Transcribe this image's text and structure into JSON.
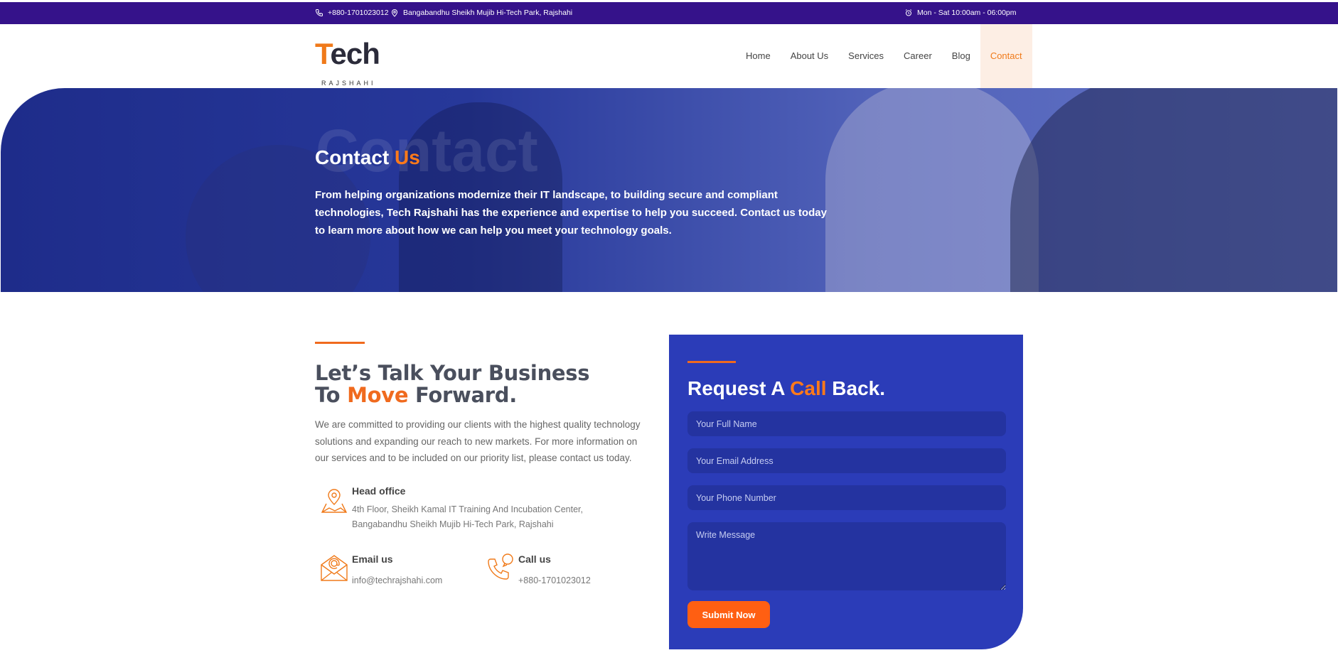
{
  "topbar": {
    "phone": "+880-1701023012",
    "address": "Bangabandhu Sheikh Mujib Hi-Tech Park, Rajshahi",
    "hours": "Mon - Sat 10:00am - 06:00pm"
  },
  "header": {
    "logo_text_first": "T",
    "logo_text_rest": "ech",
    "logo_sub": "RAJSHAHI",
    "nav": [
      {
        "label": "Home",
        "active": false
      },
      {
        "label": "About Us",
        "active": false
      },
      {
        "label": "Services",
        "active": false
      },
      {
        "label": "Career",
        "active": false
      },
      {
        "label": "Blog",
        "active": false
      },
      {
        "label": "Contact",
        "active": true
      }
    ]
  },
  "hero": {
    "ghost_text": "Contact",
    "title_main": "Contact ",
    "title_accent": "Us",
    "description": "From helping organizations modernize their IT landscape, to building secure and compliant technologies, Tech Rajshahi has the experience and expertise to help you succeed. Contact us today to learn more about how we can help you meet your technology goals."
  },
  "contact_section": {
    "heading_line1": "Let’s Talk Your Business",
    "heading_line2_pre": "To ",
    "heading_line2_accent": "Move",
    "heading_line2_post": " Forward.",
    "intro": "We are committed to providing our clients with the highest quality technology solutions and expanding our reach to new markets. For more information on our services and to be included on our priority list, please contact us today.",
    "head_office": {
      "title": "Head office",
      "line1": "4th Floor, Sheikh Kamal IT Training And Incubation Center,",
      "line2": "Bangabandhu Sheikh Mujib Hi-Tech Park, Rajshahi"
    },
    "email": {
      "title": "Email us",
      "value": "info@techrajshahi.com"
    },
    "call": {
      "title": "Call us",
      "value": "+880-1701023012"
    }
  },
  "form": {
    "heading_pre": "Request A ",
    "heading_accent": "Call",
    "heading_post": " Back.",
    "name_placeholder": "Your Full Name",
    "email_placeholder": "Your Email Address",
    "phone_placeholder": "Your Phone Number",
    "message_placeholder": "Write Message",
    "submit_label": "Submit Now"
  },
  "colors": {
    "topbar": "#35128a",
    "accent": "#f06a1e",
    "card": "#2b3cb8",
    "hero": "#27389a"
  }
}
